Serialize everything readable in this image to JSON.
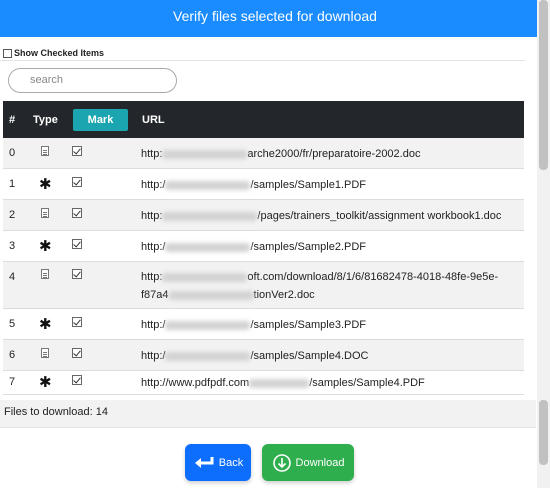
{
  "header": {
    "title": "Verify files selected for download"
  },
  "filter": {
    "show_checked_label": "Show Checked Items",
    "search_placeholder": "search"
  },
  "table": {
    "headers": {
      "index": "#",
      "type": "Type",
      "mark": "Mark",
      "url": "URL"
    },
    "rows": [
      {
        "index": "0",
        "type_icon": "document-icon",
        "url_start": "http:",
        "url_end": "arche2000/fr/preparatoire-2002.doc",
        "url_end2": ""
      },
      {
        "index": "1",
        "type_icon": "asterisk-icon",
        "url_start": "http:/",
        "url_end": "/samples/Sample1.PDF",
        "url_end2": ""
      },
      {
        "index": "2",
        "type_icon": "document-icon",
        "url_start": "http:",
        "url_end": "/pages/trainers_toolkit/assignment workbook1.doc",
        "url_end2": ""
      },
      {
        "index": "3",
        "type_icon": "asterisk-icon",
        "url_start": "http:/",
        "url_end": "/samples/Sample2.PDF",
        "url_end2": ""
      },
      {
        "index": "4",
        "type_icon": "document-icon",
        "url_start": "http:",
        "url_end": "oft.com/download/8/1/6/81682478-4018-48fe-9e5e-",
        "url_start2": "f87a4",
        "url_end2": "tionVer2.doc"
      },
      {
        "index": "5",
        "type_icon": "asterisk-icon",
        "url_start": "http:/",
        "url_end": "/samples/Sample3.PDF",
        "url_end2": ""
      },
      {
        "index": "6",
        "type_icon": "document-icon",
        "url_start": "http:/",
        "url_end": "/samples/Sample4.DOC",
        "url_end2": ""
      },
      {
        "index": "7",
        "type_icon": "asterisk-icon",
        "url_start": "http://www.pdfpdf.com",
        "url_end": "/samples/Sample4.PDF",
        "url_end2": ""
      }
    ]
  },
  "footer": {
    "files_to_download": "Files to download: 14"
  },
  "buttons": {
    "back_label": "Back",
    "download_label": "Download"
  },
  "colors": {
    "header": "#1a8cff",
    "mark": "#1ba5b0",
    "back": "#0d6efd",
    "download": "#2fae4e",
    "table_head": "#23272b"
  }
}
